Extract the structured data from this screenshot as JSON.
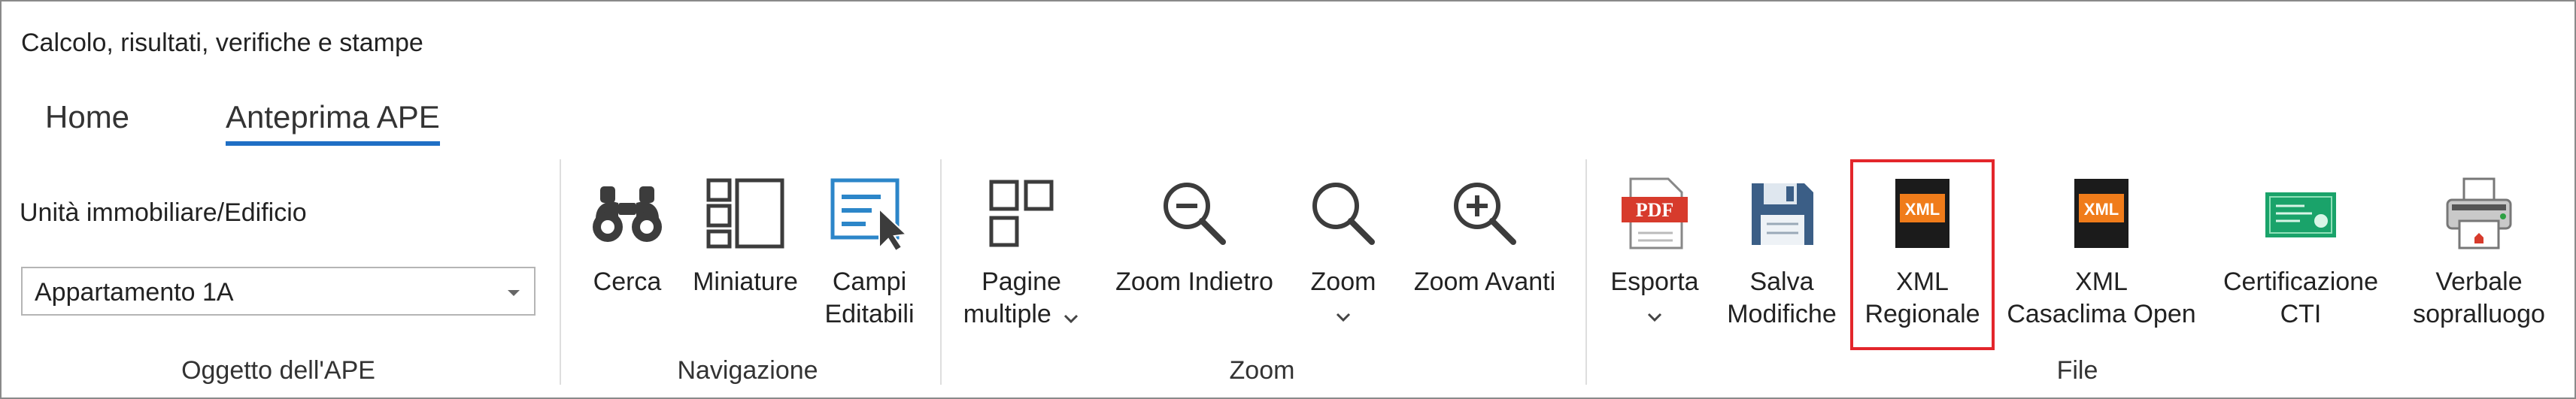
{
  "window": {
    "title": "Calcolo, risultati, verifiche e stampe"
  },
  "tabs": [
    {
      "label": "Home",
      "active": false
    },
    {
      "label": "Anteprima APE",
      "active": true
    }
  ],
  "groups": {
    "oggetto": {
      "label": "Oggetto dell'APE",
      "field_label": "Unità immobiliare/Edificio",
      "selected": "Appartamento 1A"
    },
    "navigazione": {
      "label": "Navigazione",
      "cerca": "Cerca",
      "miniature": "Miniature",
      "campi_1": "Campi",
      "campi_2": "Editabili"
    },
    "zoom": {
      "label": "Zoom",
      "pagine_1": "Pagine",
      "pagine_2": "multiple",
      "zoom_indietro": "Zoom Indietro",
      "zoom": "Zoom",
      "zoom_avanti": "Zoom Avanti"
    },
    "file": {
      "label": "File",
      "esporta": "Esporta",
      "salva_1": "Salva",
      "salva_2": "Modifiche",
      "xmlreg_1": "XML",
      "xmlreg_2": "Regionale",
      "xmlcasa_1": "XML",
      "xmlcasa_2": "Casaclima Open",
      "cert_1": "Certificazione",
      "cert_2": "CTI",
      "verb_1": "Verbale",
      "verb_2": "sopralluogo",
      "pdf_badge": "PDF",
      "xml_badge": "XML"
    }
  },
  "colors": {
    "accent": "#1f6fc5",
    "highlight": "#e3262b",
    "pdf_red": "#d73b2c",
    "xml_orange": "#f07c1a",
    "cert_green": "#1aa36a"
  },
  "icons": [
    "binoculars-icon",
    "thumbnails-icon",
    "editable-fields-icon",
    "multiple-pages-icon",
    "zoom-out-icon",
    "zoom-icon",
    "zoom-in-icon",
    "pdf-export-icon",
    "floppy-save-icon",
    "xml-icon",
    "certificate-icon",
    "printer-icon",
    "chevron-down-icon"
  ]
}
